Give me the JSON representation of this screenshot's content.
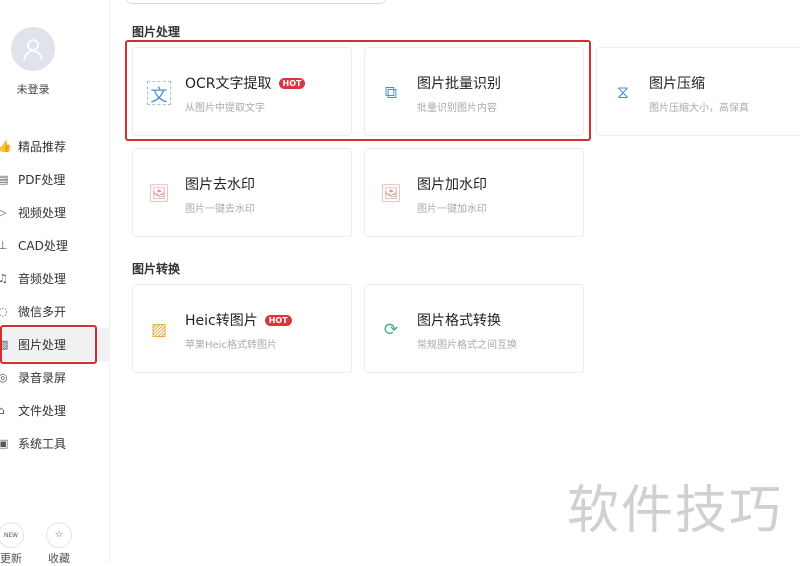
{
  "sidebar": {
    "user_label": "未登录",
    "items": [
      {
        "label": "精品推荐",
        "icon": "thumb-up-icon"
      },
      {
        "label": "PDF处理",
        "icon": "pdf-icon"
      },
      {
        "label": "视频处理",
        "icon": "video-icon"
      },
      {
        "label": "CAD处理",
        "icon": "cad-icon"
      },
      {
        "label": "音频处理",
        "icon": "music-icon"
      },
      {
        "label": "微信多开",
        "icon": "wechat-icon"
      },
      {
        "label": "图片处理",
        "icon": "image-icon",
        "active": true
      },
      {
        "label": "录音录屏",
        "icon": "record-icon"
      },
      {
        "label": "文件处理",
        "icon": "folder-icon"
      },
      {
        "label": "系统工具",
        "icon": "system-icon"
      }
    ],
    "update_label": "更新",
    "update_badge": "NEW",
    "favorite_label": "收藏"
  },
  "sections": [
    {
      "title": "图片处理",
      "cards": [
        {
          "title": "OCR文字提取",
          "badge": "HOT",
          "subtitle": "从图片中提取文字"
        },
        {
          "title": "图片批量识别",
          "subtitle": "批量识别图片内容"
        },
        {
          "title": "图片压缩",
          "subtitle": "图片压缩大小，高保真"
        },
        {
          "title": "图片去水印",
          "subtitle": "图片一键去水印"
        },
        {
          "title": "图片加水印",
          "subtitle": "图片一键加水印"
        }
      ]
    },
    {
      "title": "图片转换",
      "cards": [
        {
          "title": "Heic转图片",
          "badge": "HOT",
          "subtitle": "苹果Heic格式转图片"
        },
        {
          "title": "图片格式转换",
          "subtitle": "常规图片格式之间互换"
        }
      ]
    }
  ],
  "watermark": "软件技巧"
}
